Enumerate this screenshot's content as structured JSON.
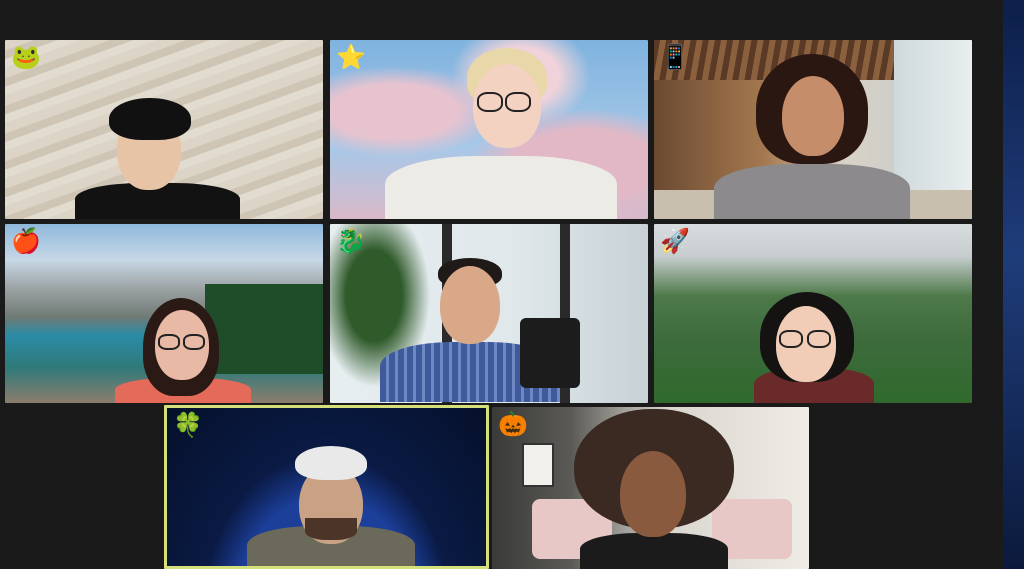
{
  "meeting": {
    "view": "gallery",
    "participants": [
      {
        "badge": "🐸",
        "background": "sand-dunes"
      },
      {
        "badge": "⭐",
        "background": "clouds"
      },
      {
        "badge": "📱",
        "background": "office"
      },
      {
        "badge": "🍎",
        "background": "mountain-lake"
      },
      {
        "badge": "🐉",
        "background": "palm-window"
      },
      {
        "badge": "🚀",
        "background": "green-mountains"
      },
      {
        "badge": "🍀",
        "background": "earth-from-space",
        "active_speaker": true
      },
      {
        "badge": "🎃",
        "background": "living-room"
      }
    ]
  },
  "colors": {
    "active_speaker_border": "#d6e07a",
    "window_bg": "#1a1a1a"
  }
}
